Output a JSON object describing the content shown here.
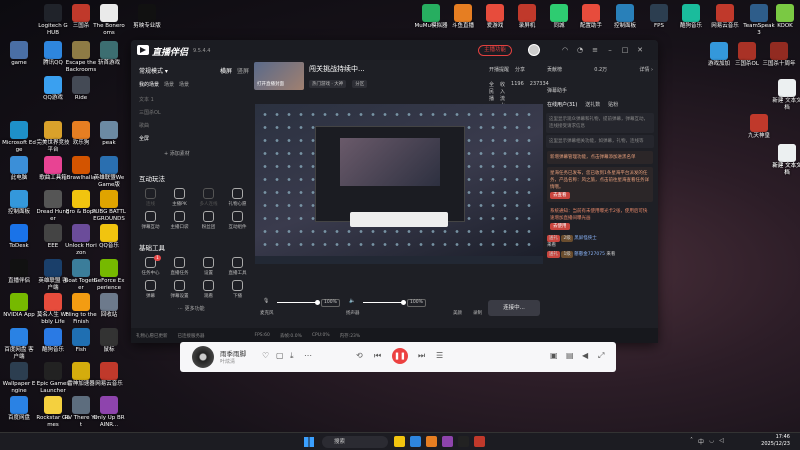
{
  "desktop": {
    "icons": [
      {
        "label": "game",
        "color": "#4a6fa5"
      },
      {
        "label": "Logitech G HUB",
        "color": "#20232a"
      },
      {
        "label": "三国杀",
        "color": "#c0392b"
      },
      {
        "label": "The Bonerooms",
        "color": "#eaeaea"
      },
      {
        "label": "剪映专业版",
        "color": "#111111"
      },
      {
        "label": "腾讯QQ",
        "color": "#2e86de"
      },
      {
        "label": "Escape the Backrooms",
        "color": "#8e7b45"
      },
      {
        "label": "斩首游戏",
        "color": "#3c6e71"
      },
      {
        "label": "QQ游戏",
        "color": "#3aa0f0"
      },
      {
        "label": "Ride",
        "color": "#444a55"
      },
      {
        "label": "Microsoft Edge",
        "color": "#1e90c8"
      },
      {
        "label": "完美世界竞技平台",
        "color": "#d9a12b"
      },
      {
        "label": "欢乐狗",
        "color": "#e67e22"
      },
      {
        "label": "peak",
        "color": "#6c8aa3"
      },
      {
        "label": "此电脑",
        "color": "#3b8fd8"
      },
      {
        "label": "歌曲工具箱",
        "color": "#e84393"
      },
      {
        "label": "Brawlhalla",
        "color": "#d35400"
      },
      {
        "label": "英雄联盟WeGame版",
        "color": "#2a6fb0"
      },
      {
        "label": "控制面板",
        "color": "#3498db"
      },
      {
        "label": "Dread Hunger",
        "color": "#555555"
      },
      {
        "label": "Bro & Bops",
        "color": "#f1c40f"
      },
      {
        "label": "PUBG BATTLEGROUNDS",
        "color": "#e0a400"
      },
      {
        "label": "ToDesk",
        "color": "#1a73e8"
      },
      {
        "label": "EEE",
        "color": "#444444"
      },
      {
        "label": "Unlock Horizon",
        "color": "#6b4c9a"
      },
      {
        "label": "QQ音乐",
        "color": "#f1c40f"
      },
      {
        "label": "直播伴侣",
        "color": "#111111"
      },
      {
        "label": "英雄联盟 客户端",
        "color": "#1a3f6a"
      },
      {
        "label": "Boat Together",
        "color": "#3b7d9a"
      },
      {
        "label": "GeForce Experience",
        "color": "#76b900"
      },
      {
        "label": "NVIDIA App",
        "color": "#76b900"
      },
      {
        "label": "莫名人生 Wobbly Life",
        "color": "#e74c3c"
      },
      {
        "label": "Fling to the Finish",
        "color": "#f39c12"
      },
      {
        "label": "回收站",
        "color": "#6d7a8c"
      },
      {
        "label": "百度网盘 客户端",
        "color": "#2a82e4"
      },
      {
        "label": "酷狗音乐",
        "color": "#2a7ae4"
      },
      {
        "label": "Fish",
        "color": "#1f6fb2"
      },
      {
        "label": "鼠标",
        "color": "#333333"
      },
      {
        "label": "Wallpaper Engine",
        "color": "#2c3e50"
      },
      {
        "label": "Epic Games Launcher",
        "color": "#222222"
      },
      {
        "label": "雷神加速器",
        "color": "#d4ac0d"
      },
      {
        "label": "网易云音乐",
        "color": "#c0392b"
      },
      {
        "label": "百度网盘",
        "color": "#2a82e4"
      },
      {
        "label": "Rockstar Games",
        "color": "#f4d03f"
      },
      {
        "label": "RV There Yet",
        "color": "#5d6d7e"
      },
      {
        "label": "Only Up BRAINR...",
        "color": "#8e44ad"
      },
      {
        "label": "MuMu模拟器",
        "color": "#27ae60"
      },
      {
        "label": "斗鱼直播",
        "color": "#e67e22"
      },
      {
        "label": "爱游戏",
        "color": "#e74c3c"
      },
      {
        "label": "录屏机",
        "color": "#c0392b"
      },
      {
        "label": "同城",
        "color": "#2ecc71"
      },
      {
        "label": "配置助手",
        "color": "#e74c3c"
      },
      {
        "label": "控制面板",
        "color": "#2980b9"
      },
      {
        "label": "FPS",
        "color": "#2c3e50"
      },
      {
        "label": "酷狗音乐",
        "color": "#1abc9c"
      },
      {
        "label": "网易云音乐",
        "color": "#c0392b"
      },
      {
        "label": "TeamSpeak 3",
        "color": "#2e5d8a"
      },
      {
        "label": "KOOK",
        "color": "#7ac943"
      },
      {
        "label": "游戏加加",
        "color": "#3498db"
      },
      {
        "label": "三国杀OL",
        "color": "#a93226"
      },
      {
        "label": "三国杀十周年",
        "color": "#922b21"
      },
      {
        "label": "新建 文本文档",
        "color": "#ecf0f1"
      },
      {
        "label": "九天神皇",
        "color": "#c0392b"
      },
      {
        "label": "新建 文本文档",
        "color": "#ecf0f1"
      },
      {
        "label": "新建 文本文档",
        "color": "#ecf0f1"
      }
    ]
  },
  "app": {
    "name": "直播伴侣",
    "version": "9.5.4.4",
    "open_live_label": "主播功能",
    "mode_label": "常规模式",
    "mode_options": [
      "横屏",
      "竖屏"
    ],
    "scene_tabs": [
      "我的场景",
      "场景",
      "场景"
    ],
    "sources": [
      "文本 1",
      "三国杀OL",
      "歌曲",
      "全屏"
    ],
    "add_source": "+ 添加素材",
    "section_interact": "互动玩法",
    "interact_items": [
      {
        "label": "连线",
        "dim": true
      },
      {
        "label": "主播PK",
        "dim": false
      },
      {
        "label": "多人连线",
        "dim": true
      },
      {
        "label": "礼物心愿",
        "dim": false
      },
      {
        "label": "弹幕互动",
        "dim": false
      },
      {
        "label": "主播口袋",
        "dim": false
      },
      {
        "label": "粉丝团",
        "dim": false
      },
      {
        "label": "互动组件",
        "dim": false
      }
    ],
    "section_basic": "基础工具",
    "basic_items": [
      {
        "label": "任务中心",
        "badge": "1"
      },
      {
        "label": "直播任务",
        "badge": ""
      },
      {
        "label": "设置",
        "badge": ""
      },
      {
        "label": "直播工具",
        "badge": ""
      },
      {
        "label": "弹幕",
        "badge": ""
      },
      {
        "label": "弹幕设置",
        "badge": ""
      },
      {
        "label": "观看",
        "badge": ""
      },
      {
        "label": "下播",
        "badge": ""
      }
    ],
    "more_fn": "更多功能",
    "room": {
      "title": "闯关挑战持续中...",
      "thumb_label": "打开直播封面",
      "tags": [
        "热门游戏 · 大神",
        "分区"
      ],
      "actions": [
        "开播提醒",
        "分享"
      ],
      "stats": [
        "全民播",
        "收入流水",
        "1196",
        "237334"
      ]
    },
    "stage_row": [
      "模式",
      "多主播",
      "直播",
      "截图",
      "工具"
    ],
    "audio": {
      "mic_label": "麦克风",
      "mic_pct": "100%",
      "speaker_label": "扬声器",
      "speaker_pct": "100%",
      "extra": [
        "美颜",
        "录制",
        "设置"
      ]
    },
    "start_label": "连接中...",
    "status": [
      "礼物心愿已更新",
      "已连接服务器",
      "FPS:60",
      "丢帧:0.0%",
      "CPU:0%",
      "内存:23%"
    ],
    "right": {
      "head_left": "贡献榜",
      "head_mid": "0.2万",
      "head_right": "详情 ›",
      "danmu_title": "弹幕助手",
      "tabs": [
        "在线用户(31)",
        "送礼数",
        "贴粉"
      ],
      "desc1": "这里显示观众弹幕和礼物，提前弹幕，弹幕互动，连线接受请求信息",
      "desc2": "这里显示弹幕相关功能，如弹幕，礼物，连线等",
      "notice": "新增弹幕管理功能，点击弹幕添加进黑名单",
      "notice2": "星海任务已发布，您已收到1条星海平台派发的任务，产品名称：风之旅，点击前往星海查看任务详情哦。",
      "go_view": "去查看",
      "sys": "系统通知：当前有未使用曝光卡2张，使用后可快速增加直播间曝光画",
      "go_use": "去使用",
      "chats": [
        {
          "tag": "送礼",
          "tag2": "2级",
          "name": "黑屏怪侠士",
          "text": "来看"
        },
        {
          "tag": "送礼",
          "tag2": "1级",
          "name": "憨憨金727075",
          "text": "来看"
        }
      ],
      "counts": [
        "0.0",
        "0.0/0.0人"
      ]
    }
  },
  "music": {
    "title": "雨季雨脚",
    "artist": "叶炫清",
    "play_symbol": "❚❚"
  },
  "taskbar": {
    "search": "搜索",
    "time": "17:46",
    "date": "2025/12/23",
    "lang": "中"
  }
}
